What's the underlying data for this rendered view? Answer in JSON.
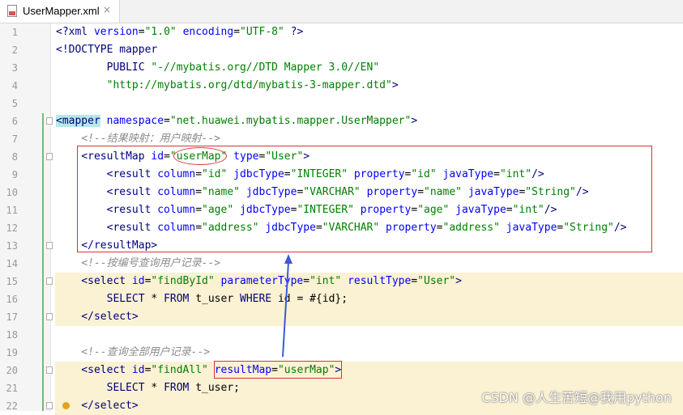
{
  "tab": {
    "title": "UserMapper.xml",
    "close": "×"
  },
  "colors": {
    "tag": "#000080",
    "attr": "#0000ff",
    "value": "#008000",
    "comment": "#8c8c8c",
    "highlight": "#fbf1d3",
    "annotation": "#d63434",
    "arrow": "#3b5bd6"
  },
  "lines": [
    {
      "n": "1",
      "tokens": [
        {
          "k": "tag",
          "t": "<?xml "
        },
        {
          "k": "attr",
          "t": "version"
        },
        {
          "k": "plain",
          "t": "="
        },
        {
          "k": "val",
          "t": "\"1.0\""
        },
        {
          "k": "plain",
          "t": " "
        },
        {
          "k": "attr",
          "t": "encoding"
        },
        {
          "k": "plain",
          "t": "="
        },
        {
          "k": "val",
          "t": "\"UTF-8\""
        },
        {
          "k": "plain",
          "t": " "
        },
        {
          "k": "tag",
          "t": "?>"
        }
      ]
    },
    {
      "n": "2",
      "tokens": [
        {
          "k": "tag",
          "t": "<!DOCTYPE mapper"
        }
      ]
    },
    {
      "n": "3",
      "tokens": [
        {
          "k": "tag",
          "t": "        PUBLIC "
        },
        {
          "k": "val",
          "t": "\"-//mybatis.org//DTD Mapper 3.0//EN\""
        }
      ]
    },
    {
      "n": "4",
      "tokens": [
        {
          "k": "val",
          "t": "        \"http://mybatis.org/dtd/mybatis-3-mapper.dtd\""
        },
        {
          "k": "tag",
          "t": ">"
        }
      ]
    },
    {
      "n": "5",
      "tokens": []
    },
    {
      "n": "6",
      "fold": true,
      "tokens": [
        {
          "k": "taghl",
          "t": "<mapper"
        },
        {
          "k": "plain",
          "t": " "
        },
        {
          "k": "attr",
          "t": "namespace"
        },
        {
          "k": "plain",
          "t": "="
        },
        {
          "k": "val",
          "t": "\"net.huawei.mybatis.mapper.UserMapper\""
        },
        {
          "k": "tag",
          "t": ">"
        }
      ]
    },
    {
      "n": "7",
      "tokens": [
        {
          "k": "com",
          "t": "    <!--结果映射：用户映射-->"
        }
      ]
    },
    {
      "n": "8",
      "fold": true,
      "tokens": [
        {
          "k": "tag",
          "t": "    <resultMap "
        },
        {
          "k": "attr",
          "t": "id"
        },
        {
          "k": "plain",
          "t": "="
        },
        {
          "k": "val",
          "t": "\"userMap\""
        },
        {
          "k": "plain",
          "t": " "
        },
        {
          "k": "attr",
          "t": "type"
        },
        {
          "k": "plain",
          "t": "="
        },
        {
          "k": "val",
          "t": "\"User\""
        },
        {
          "k": "tag",
          "t": ">"
        }
      ]
    },
    {
      "n": "9",
      "tokens": [
        {
          "k": "tag",
          "t": "        <result "
        },
        {
          "k": "attr",
          "t": "column"
        },
        {
          "k": "plain",
          "t": "="
        },
        {
          "k": "val",
          "t": "\"id\""
        },
        {
          "k": "plain",
          "t": " "
        },
        {
          "k": "attr",
          "t": "jdbcType"
        },
        {
          "k": "plain",
          "t": "="
        },
        {
          "k": "val",
          "t": "\"INTEGER\""
        },
        {
          "k": "plain",
          "t": " "
        },
        {
          "k": "attr",
          "t": "property"
        },
        {
          "k": "plain",
          "t": "="
        },
        {
          "k": "val",
          "t": "\"id\""
        },
        {
          "k": "plain",
          "t": " "
        },
        {
          "k": "attr",
          "t": "javaType"
        },
        {
          "k": "plain",
          "t": "="
        },
        {
          "k": "val",
          "t": "\"int\""
        },
        {
          "k": "tag",
          "t": "/>"
        }
      ]
    },
    {
      "n": "10",
      "tokens": [
        {
          "k": "tag",
          "t": "        <result "
        },
        {
          "k": "attr",
          "t": "column"
        },
        {
          "k": "plain",
          "t": "="
        },
        {
          "k": "val",
          "t": "\"name\""
        },
        {
          "k": "plain",
          "t": " "
        },
        {
          "k": "attr",
          "t": "jdbcType"
        },
        {
          "k": "plain",
          "t": "="
        },
        {
          "k": "val",
          "t": "\"VARCHAR\""
        },
        {
          "k": "plain",
          "t": " "
        },
        {
          "k": "attr",
          "t": "property"
        },
        {
          "k": "plain",
          "t": "="
        },
        {
          "k": "val",
          "t": "\"name\""
        },
        {
          "k": "plain",
          "t": " "
        },
        {
          "k": "attr",
          "t": "javaType"
        },
        {
          "k": "plain",
          "t": "="
        },
        {
          "k": "val",
          "t": "\"String\""
        },
        {
          "k": "tag",
          "t": "/>"
        }
      ]
    },
    {
      "n": "11",
      "tokens": [
        {
          "k": "tag",
          "t": "        <result "
        },
        {
          "k": "attr",
          "t": "column"
        },
        {
          "k": "plain",
          "t": "="
        },
        {
          "k": "val",
          "t": "\"age\""
        },
        {
          "k": "plain",
          "t": " "
        },
        {
          "k": "attr",
          "t": "jdbcType"
        },
        {
          "k": "plain",
          "t": "="
        },
        {
          "k": "val",
          "t": "\"INTEGER\""
        },
        {
          "k": "plain",
          "t": " "
        },
        {
          "k": "attr",
          "t": "property"
        },
        {
          "k": "plain",
          "t": "="
        },
        {
          "k": "val",
          "t": "\"age\""
        },
        {
          "k": "plain",
          "t": " "
        },
        {
          "k": "attr",
          "t": "javaType"
        },
        {
          "k": "plain",
          "t": "="
        },
        {
          "k": "val",
          "t": "\"int\""
        },
        {
          "k": "tag",
          "t": "/>"
        }
      ]
    },
    {
      "n": "12",
      "tokens": [
        {
          "k": "tag",
          "t": "        <result "
        },
        {
          "k": "attr",
          "t": "column"
        },
        {
          "k": "plain",
          "t": "="
        },
        {
          "k": "val",
          "t": "\"address\""
        },
        {
          "k": "plain",
          "t": " "
        },
        {
          "k": "attr",
          "t": "jdbcType"
        },
        {
          "k": "plain",
          "t": "="
        },
        {
          "k": "val",
          "t": "\"VARCHAR\""
        },
        {
          "k": "plain",
          "t": " "
        },
        {
          "k": "attr",
          "t": "property"
        },
        {
          "k": "plain",
          "t": "="
        },
        {
          "k": "val",
          "t": "\"address\""
        },
        {
          "k": "plain",
          "t": " "
        },
        {
          "k": "attr",
          "t": "javaType"
        },
        {
          "k": "plain",
          "t": "="
        },
        {
          "k": "val",
          "t": "\"String\""
        },
        {
          "k": "tag",
          "t": "/>"
        }
      ]
    },
    {
      "n": "13",
      "fold": true,
      "tokens": [
        {
          "k": "tag",
          "t": "    </resultMap>"
        }
      ]
    },
    {
      "n": "14",
      "tokens": [
        {
          "k": "com",
          "t": "    <!--按编号查询用户记录-->"
        }
      ]
    },
    {
      "n": "15",
      "fold": true,
      "highlight": true,
      "tokens": [
        {
          "k": "tag",
          "t": "    <select "
        },
        {
          "k": "attr",
          "t": "id"
        },
        {
          "k": "plain",
          "t": "="
        },
        {
          "k": "val",
          "t": "\"findById\""
        },
        {
          "k": "plain",
          "t": " "
        },
        {
          "k": "attr",
          "t": "parameterType"
        },
        {
          "k": "plain",
          "t": "="
        },
        {
          "k": "val",
          "t": "\"int\""
        },
        {
          "k": "plain",
          "t": " "
        },
        {
          "k": "attr",
          "t": "resultType"
        },
        {
          "k": "plain",
          "t": "="
        },
        {
          "k": "val",
          "t": "\"User\""
        },
        {
          "k": "tag",
          "t": ">"
        }
      ]
    },
    {
      "n": "16",
      "highlight": true,
      "tokens": [
        {
          "k": "kw",
          "t": "        SELECT "
        },
        {
          "k": "plain",
          "t": "* "
        },
        {
          "k": "kw",
          "t": "FROM "
        },
        {
          "k": "plain",
          "t": "t_user "
        },
        {
          "k": "kw",
          "t": "WHERE "
        },
        {
          "k": "plain",
          "t": "id = #{id};"
        }
      ]
    },
    {
      "n": "17",
      "fold": true,
      "highlight": true,
      "tokens": [
        {
          "k": "tag",
          "t": "    </select>"
        }
      ]
    },
    {
      "n": "18",
      "tokens": []
    },
    {
      "n": "19",
      "tokens": [
        {
          "k": "com",
          "t": "    <!--查询全部用户记录-->"
        }
      ]
    },
    {
      "n": "20",
      "fold": true,
      "highlight": true,
      "tokens": [
        {
          "k": "tag",
          "t": "    <select "
        },
        {
          "k": "attr",
          "t": "id"
        },
        {
          "k": "plain",
          "t": "="
        },
        {
          "k": "val",
          "t": "\"findAll\""
        },
        {
          "k": "plain",
          "t": " "
        },
        {
          "k": "attr",
          "t": "resultMap"
        },
        {
          "k": "plain",
          "t": "="
        },
        {
          "k": "val",
          "t": "\"userMap\""
        },
        {
          "k": "tag",
          "t": ">"
        }
      ]
    },
    {
      "n": "21",
      "highlight": true,
      "tokens": [
        {
          "k": "kw",
          "t": "        SELECT "
        },
        {
          "k": "plain",
          "t": "* "
        },
        {
          "k": "kw",
          "t": "FROM "
        },
        {
          "k": "plain",
          "t": "t_user;"
        }
      ]
    },
    {
      "n": "22",
      "fold": true,
      "warn": true,
      "highlight": true,
      "tokens": [
        {
          "k": "tag",
          "t": "    </select>"
        }
      ]
    }
  ],
  "watermark": "CSDN @人生苦短@我用python"
}
